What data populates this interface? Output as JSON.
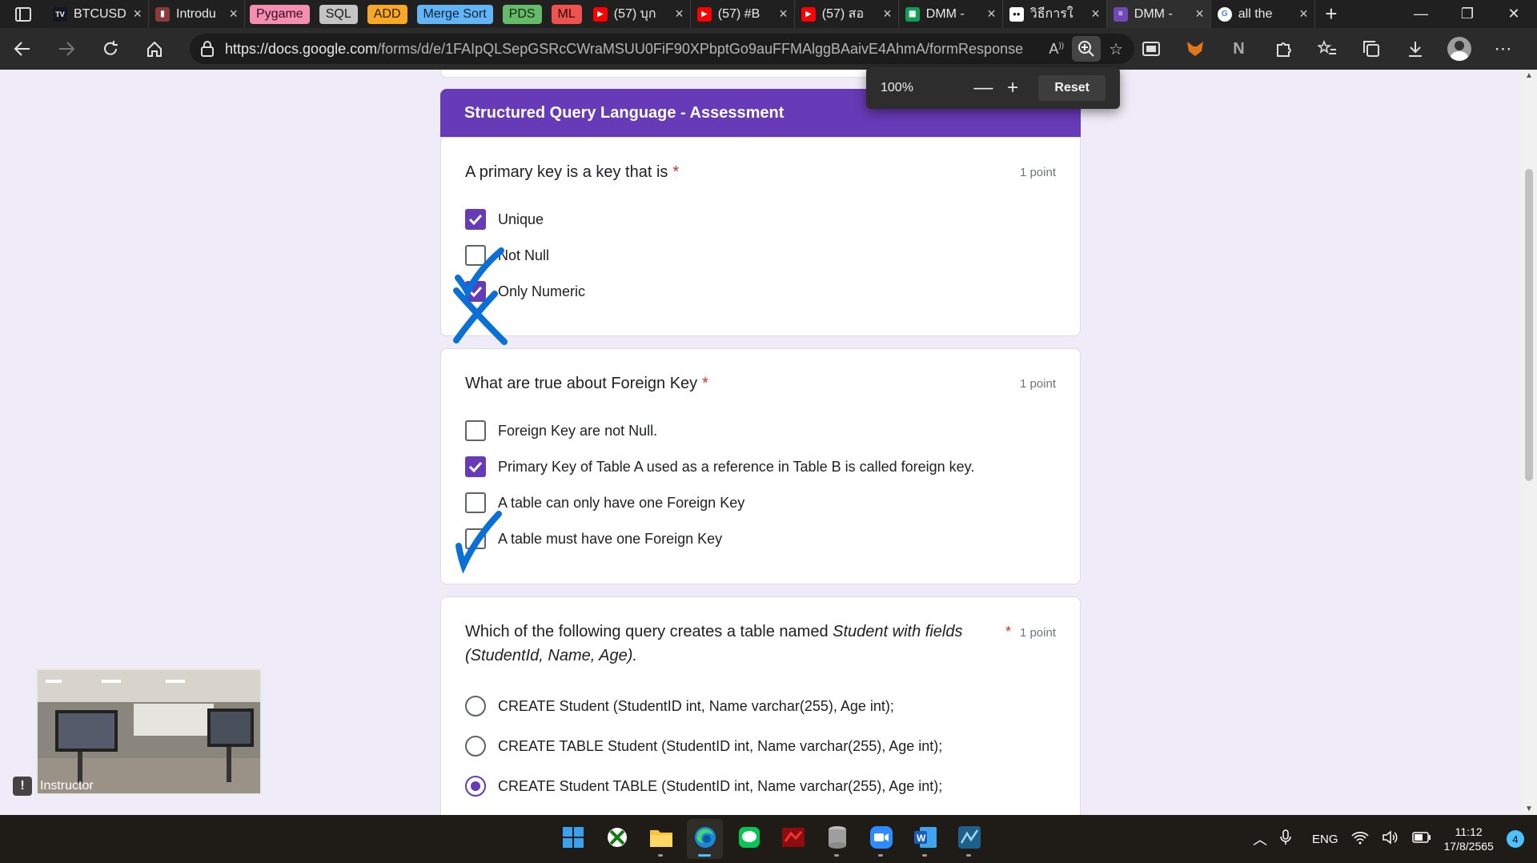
{
  "browser": {
    "tabs": [
      {
        "kind": "tab",
        "label": "BTCUSD",
        "favicon": "tradingview-icon",
        "color": "#131722",
        "width": 128
      },
      {
        "kind": "tab",
        "label": "Introdu",
        "favicon": "book-icon",
        "color": "#8b3a3a",
        "width": 120
      },
      {
        "kind": "chip",
        "label": "Pygame",
        "color": "#f48fb1",
        "text_color": "#3a0a20"
      },
      {
        "kind": "chip",
        "label": "SQL",
        "color": "#c4c4c4",
        "text_color": "#1a1a1a"
      },
      {
        "kind": "chip",
        "label": "ADD",
        "color": "#f9a825",
        "text_color": "#2a1a00"
      },
      {
        "kind": "chip",
        "label": "Merge Sort",
        "color": "#64b5f6",
        "text_color": "#06233d"
      },
      {
        "kind": "chip",
        "label": "PDS",
        "color": "#66bb6a",
        "text_color": "#0d2a0e"
      },
      {
        "kind": "chip",
        "label": "ML",
        "color": "#ef5350",
        "text_color": "#2a0000"
      },
      {
        "kind": "tab",
        "label": "(57) บุก",
        "favicon": "youtube-icon",
        "color": "#ff0000",
        "width": 130
      },
      {
        "kind": "tab",
        "label": "(57) #B",
        "favicon": "youtube-icon",
        "color": "#ff0000",
        "width": 130
      },
      {
        "kind": "tab",
        "label": "(57) สอ",
        "favicon": "youtube-icon",
        "color": "#ff0000",
        "width": 130
      },
      {
        "kind": "tab",
        "label": "DMM -",
        "favicon": "sheets-icon",
        "color": "#0f9d58",
        "width": 130
      },
      {
        "kind": "tab",
        "label": "วิธีการใ",
        "favicon": "medium-icon",
        "color": "#ffffff",
        "width": 130
      },
      {
        "kind": "tab",
        "label": "DMM -",
        "favicon": "forms-icon",
        "color": "#7248b9",
        "width": 130,
        "active": true
      },
      {
        "kind": "tab",
        "label": "all the",
        "favicon": "google-icon",
        "color": "#ffffff",
        "width": 130
      }
    ],
    "url_host": "https://docs.google.com",
    "url_path": "/forms/d/e/1FAIpQLSepGSRcCWraMSUU0FiF90XPbptGo9auFFMAlggBAaivE4AhmA/formResponse",
    "zoom_level": "100%",
    "zoom_reset_label": "Reset"
  },
  "form": {
    "section_title": "Structured Query Language - Assessment",
    "questions": [
      {
        "text": "A primary key is a key that is",
        "required_mark": "*",
        "points": "1 point",
        "type": "checkbox",
        "options": [
          {
            "label": "Unique",
            "checked": true
          },
          {
            "label": "Not Null",
            "checked": false
          },
          {
            "label": "Only Numeric",
            "checked": true
          }
        ]
      },
      {
        "text": "What are true about Foreign Key",
        "required_mark": "*",
        "points": "1 point",
        "type": "checkbox",
        "options": [
          {
            "label": "Foreign Key are not Null.",
            "checked": false
          },
          {
            "label": "Primary Key of Table A used as a reference in Table B is called foreign key.",
            "checked": true
          },
          {
            "label": "A table can only have one Foreign Key",
            "checked": false
          },
          {
            "label": "A table must have one Foreign Key",
            "checked": false
          }
        ]
      },
      {
        "text_plain": "Which of the following query creates a table named ",
        "text_italic": "Student with fields (StudentId, Name, Age).",
        "required_mark": "*",
        "points": "1 point",
        "type": "radio",
        "options": [
          {
            "label": "CREATE Student (StudentID int, Name varchar(255), Age int);",
            "checked": false
          },
          {
            "label": "CREATE TABLE Student (StudentID int, Name varchar(255), Age int);",
            "checked": false
          },
          {
            "label": "CREATE Student TABLE (StudentID int, Name varchar(255), Age int);",
            "checked": true
          }
        ]
      }
    ]
  },
  "instructor_label": "Instructor",
  "taskbar": {
    "apps": [
      {
        "name": "windows-start-icon"
      },
      {
        "name": "xbox-icon"
      },
      {
        "name": "file-explorer-icon"
      },
      {
        "name": "edge-icon",
        "active": true
      },
      {
        "name": "line-icon"
      },
      {
        "name": "app-red-icon"
      },
      {
        "name": "database-icon"
      },
      {
        "name": "zoom-icon"
      },
      {
        "name": "word-icon"
      },
      {
        "name": "workbench-icon"
      }
    ],
    "language": "ENG",
    "time": "11:12",
    "date": "17/8/2565",
    "notification_count": "4"
  },
  "colors": {
    "form_accent": "#673ab7",
    "form_background": "#f0ebf8",
    "pen_annotation": "#0a6fd6"
  }
}
